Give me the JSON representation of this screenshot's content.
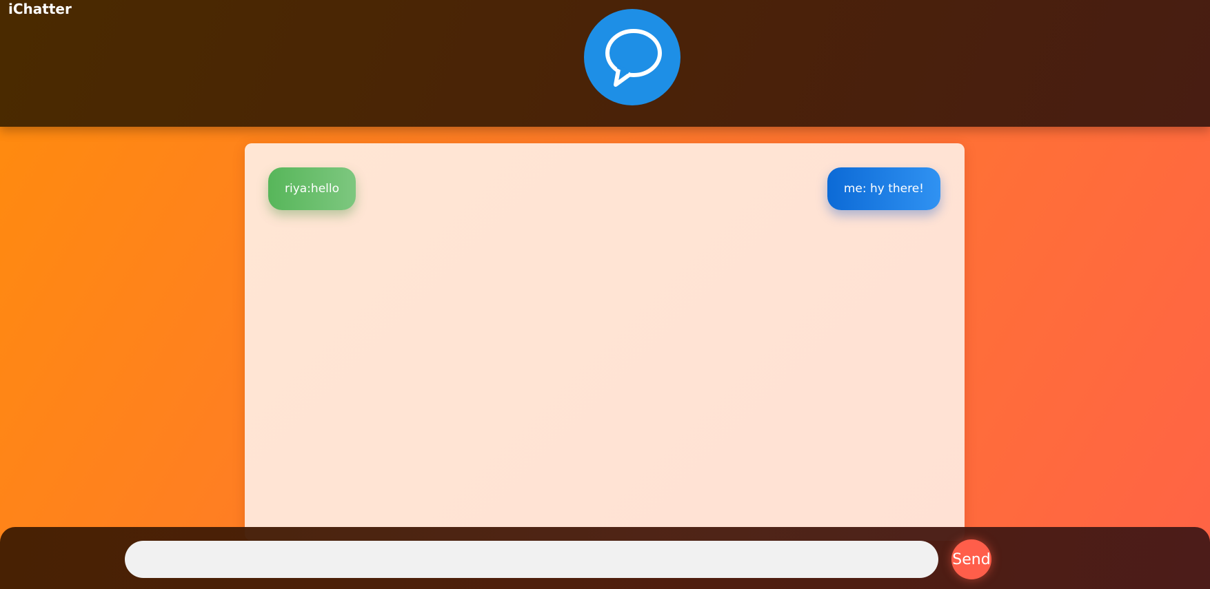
{
  "header": {
    "brand": "iChatter",
    "logo_icon": "chat-bubble-icon",
    "logo_color": "#1e8fe6"
  },
  "messages": [
    {
      "text": "riya:hello",
      "side": "left",
      "color": "#57b65a"
    },
    {
      "text": "me: hy there!",
      "side": "right",
      "color": "#1479e0"
    }
  ],
  "composer": {
    "input_value": "",
    "input_placeholder": "",
    "send_label": "Send",
    "send_color": "#ff5e4a"
  }
}
